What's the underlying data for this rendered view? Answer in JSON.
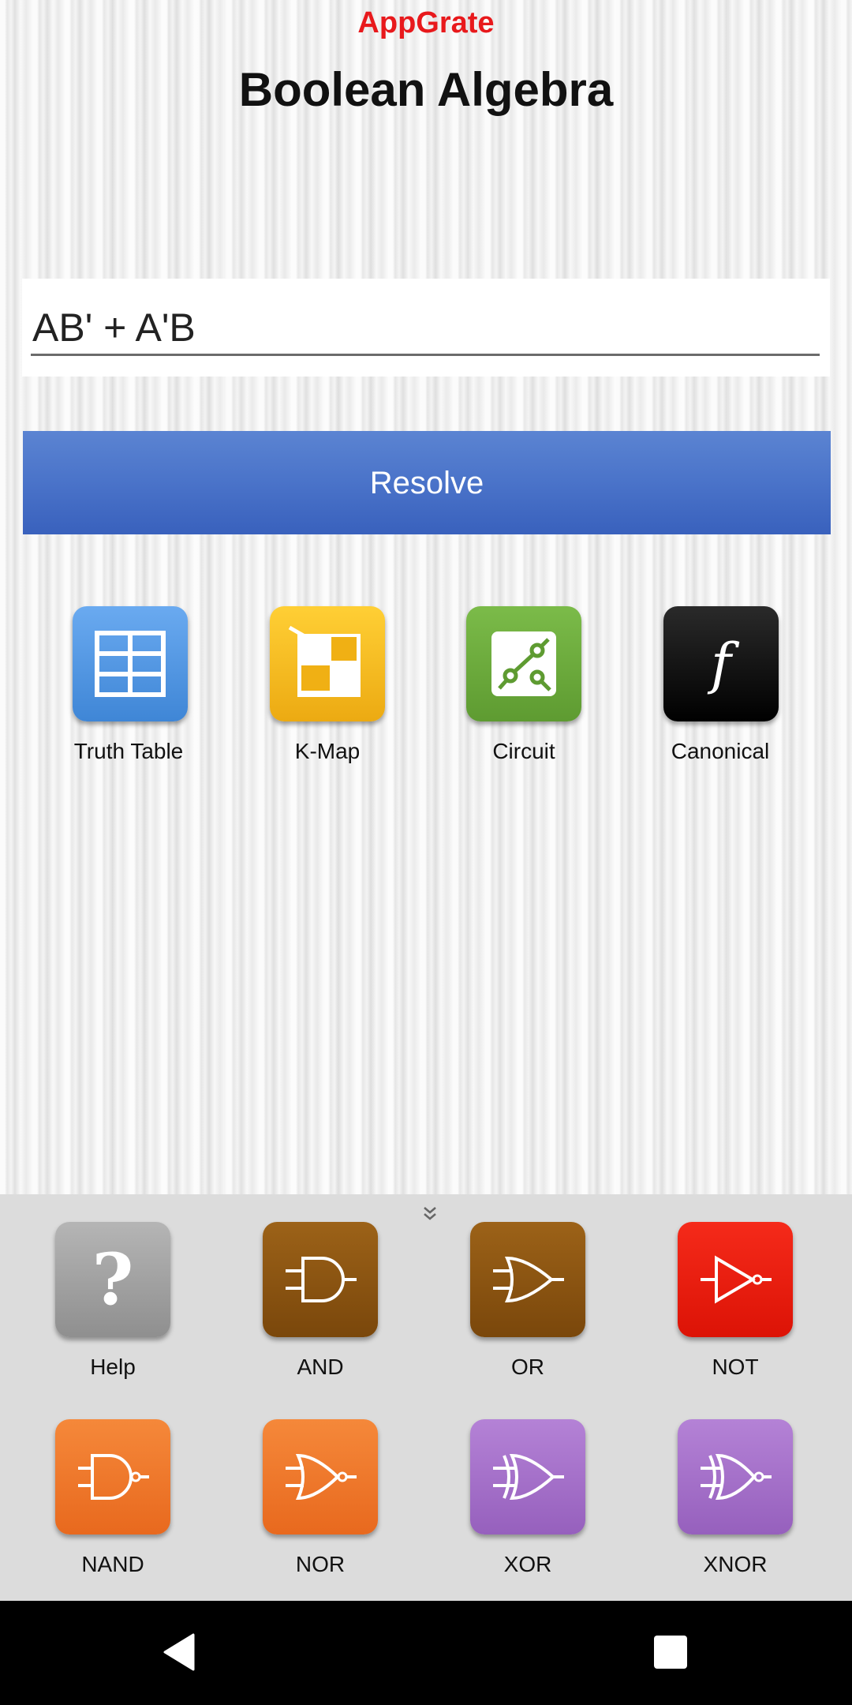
{
  "header": {
    "brand": "AppGrate",
    "title": "Boolean Algebra",
    "brand_color": "#e8191c"
  },
  "expression_input": {
    "value": "AB' + A'B"
  },
  "resolve_button": {
    "label": "Resolve",
    "color": "#4a73c9"
  },
  "tools": [
    {
      "label": "Truth Table",
      "icon": "table-icon",
      "color": "#4a8fdc"
    },
    {
      "label": "K-Map",
      "icon": "kmap-icon",
      "color": "#f3b51e"
    },
    {
      "label": "Circuit",
      "icon": "circuit-icon",
      "color": "#6aaa3c"
    },
    {
      "label": "Canonical",
      "icon": "function-icon",
      "color": "#111111",
      "glyph": "f"
    }
  ],
  "gates_panel": {
    "collapse_icon": "chevron-double-down-icon",
    "gates": [
      {
        "label": "Help",
        "icon": "question-icon",
        "glyph": "?",
        "color": "#a8a8a8"
      },
      {
        "label": "AND",
        "icon": "and-gate-icon",
        "color": "#8a5410"
      },
      {
        "label": "OR",
        "icon": "or-gate-icon",
        "color": "#8a5410"
      },
      {
        "label": "NOT",
        "icon": "not-gate-icon",
        "color": "#e8190f"
      },
      {
        "label": "NAND",
        "icon": "nand-gate-icon",
        "color": "#ee7a2a"
      },
      {
        "label": "NOR",
        "icon": "nor-gate-icon",
        "color": "#ee7a2a"
      },
      {
        "label": "XOR",
        "icon": "xor-gate-icon",
        "color": "#a46fc8"
      },
      {
        "label": "XNOR",
        "icon": "xnor-gate-icon",
        "color": "#a46fc8"
      }
    ]
  },
  "nav_bar": {
    "back_icon": "back-triangle-icon",
    "recents_icon": "recents-square-icon"
  }
}
